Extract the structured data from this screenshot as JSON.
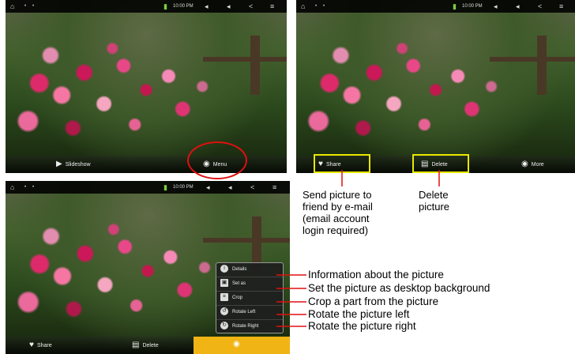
{
  "status_bar": {
    "time": "10:00 PM"
  },
  "bottom_bar": {
    "slideshow_label": "Slideshow",
    "menu_label": "Menu",
    "share_label": "Share",
    "delete_label": "Delete",
    "more_label": "More"
  },
  "popup_menu": {
    "items": [
      {
        "label": "Details",
        "icon": "info-icon"
      },
      {
        "label": "Set as",
        "icon": "set-as-icon"
      },
      {
        "label": "Crop",
        "icon": "crop-icon"
      },
      {
        "label": "Rotate Left",
        "icon": "rotate-left-icon"
      },
      {
        "label": "Rotate Right",
        "icon": "rotate-right-icon"
      }
    ]
  },
  "annotations": {
    "share_note": [
      "Send picture to",
      "friend by e-mail",
      "(email account",
      "login required)"
    ],
    "delete_note": [
      "Delete",
      "picture"
    ],
    "details_note": "Information about the picture",
    "set_as_note": "Set the picture as desktop background",
    "crop_note": "Crop a part from the picture",
    "rotate_left_note": "Rotate the picture left",
    "rotate_right_note": "Rotate the picture right"
  },
  "colors": {
    "highlight_red": "#e01010",
    "highlight_yellow": "#e8e800",
    "active_menu": "#f0b414"
  }
}
